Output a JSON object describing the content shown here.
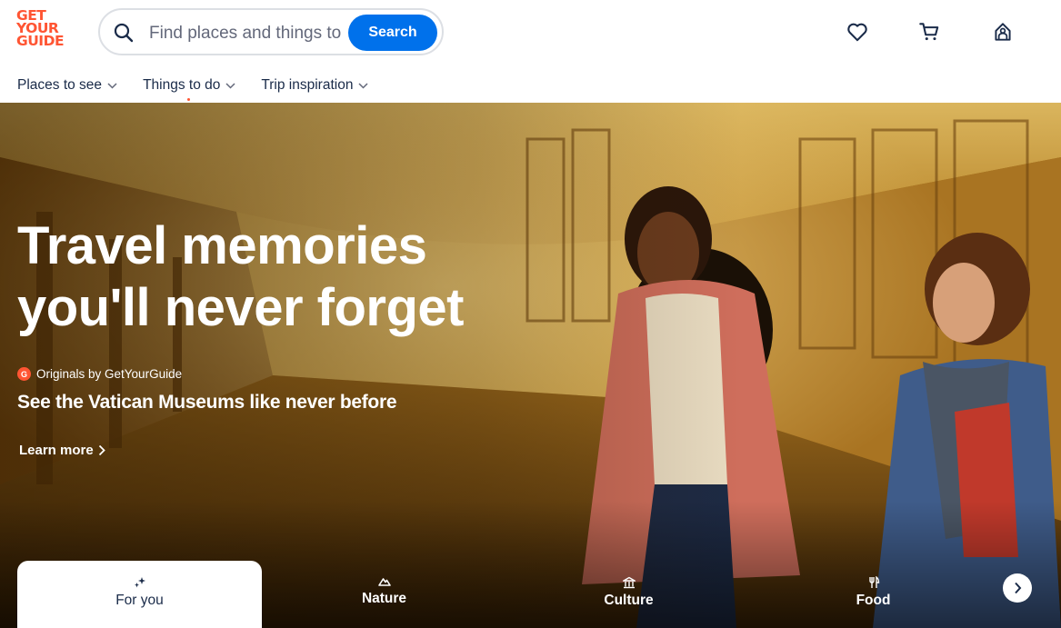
{
  "brand": {
    "logo_lines": [
      "GET",
      "YOUR",
      "GUIDE"
    ],
    "accent": "#ff5533",
    "primary": "#0071eb"
  },
  "search": {
    "placeholder": "Find places and things to do",
    "button_label": "Search"
  },
  "header_icons": [
    "heart-icon",
    "cart-icon",
    "profile-icon"
  ],
  "nav": {
    "items": [
      {
        "label": "Places to see"
      },
      {
        "label": "Things to do"
      },
      {
        "label": "Trip inspiration"
      }
    ]
  },
  "hero": {
    "title_line1": "Travel memories",
    "title_line2": "you'll never forget",
    "badge_letter": "G",
    "originals_label": "Originals by GetYourGuide",
    "subtitle": "See the Vatican Museums like never before",
    "cta_label": "Learn more"
  },
  "tabs": [
    {
      "label": "For you",
      "icon": "sparkle-icon",
      "active": true
    },
    {
      "label": "Nature",
      "icon": "mountain-icon",
      "active": false
    },
    {
      "label": "Culture",
      "icon": "museum-icon",
      "active": false
    },
    {
      "label": "Food",
      "icon": "fork-knife-icon",
      "active": false
    }
  ]
}
